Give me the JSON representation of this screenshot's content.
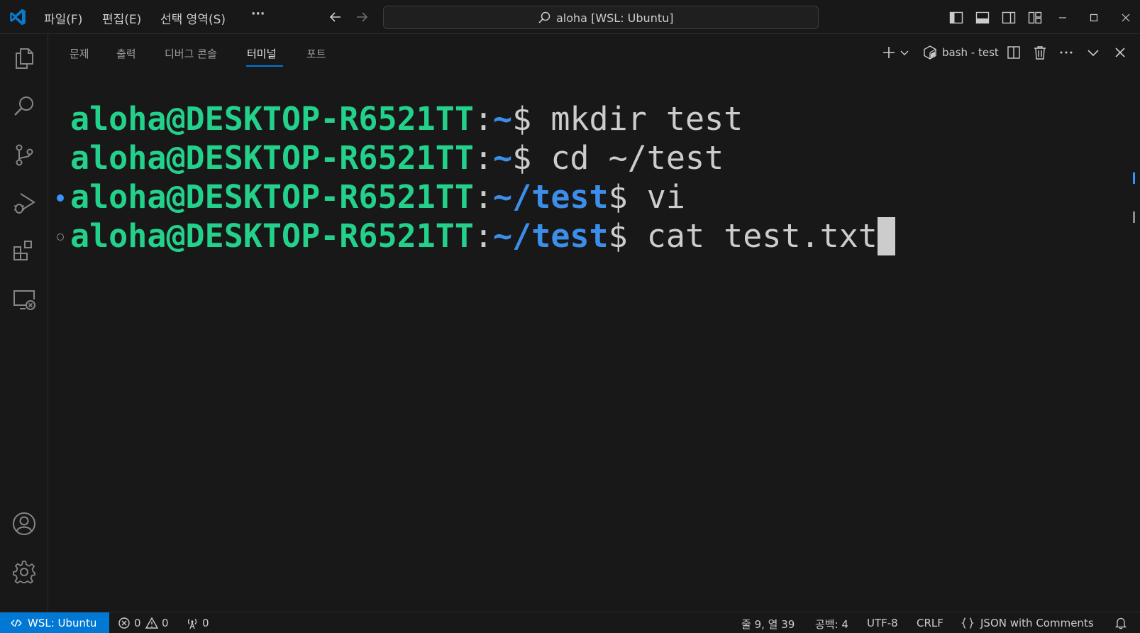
{
  "menu": {
    "file": "파일(F)",
    "edit": "편집(E)",
    "selection": "선택 영역(S)",
    "more": "···"
  },
  "search": {
    "text": "aloha [WSL: Ubuntu]"
  },
  "panel": {
    "tabs": [
      {
        "label": "문제"
      },
      {
        "label": "출력"
      },
      {
        "label": "디버그 콘솔"
      },
      {
        "label": "터미널",
        "active": true
      },
      {
        "label": "포트"
      }
    ],
    "terminal_name": "bash - test"
  },
  "terminal": {
    "lines": [
      {
        "user": "aloha@DESKTOP-R6521TT",
        "colon": ":",
        "path": "~",
        "dollar": "$",
        "command": " mkdir test"
      },
      {
        "user": "aloha@DESKTOP-R6521TT",
        "colon": ":",
        "path": "~",
        "dollar": "$",
        "command": " cd ~/test"
      },
      {
        "user": "aloha@DESKTOP-R6521TT",
        "colon": ":",
        "path": "~/test",
        "dollar": "$",
        "command": " vi"
      },
      {
        "user": "aloha@DESKTOP-R6521TT",
        "colon": ":",
        "path": "~/test",
        "dollar": "$",
        "command": " cat test.txt"
      }
    ]
  },
  "statusbar": {
    "remote": "WSL: Ubuntu",
    "errors": "0",
    "warnings": "0",
    "ports": "0",
    "position": "줄 9, 열 39",
    "spaces": "공백: 4",
    "encoding": "UTF-8",
    "eol": "CRLF",
    "language": "JSON with Comments"
  },
  "colors": {
    "accent": "#0078d4",
    "prompt_user": "#23d18b",
    "prompt_path": "#3b8eea",
    "background": "#181818"
  },
  "icons": {
    "title": [
      "vscode-logo",
      "arrow-left-icon",
      "arrow-right-icon",
      "search-icon",
      "toggle-primary-sidebar-icon",
      "toggle-panel-icon",
      "toggle-secondary-sidebar-icon",
      "customize-layout-icon",
      "minimize-icon",
      "maximize-icon",
      "close-icon"
    ],
    "activity": [
      "explorer-icon",
      "search-icon",
      "source-control-icon",
      "run-debug-icon",
      "extensions-icon",
      "remote-explorer-icon",
      "accounts-icon",
      "manage-gear-icon"
    ],
    "panel": [
      "new-terminal-icon",
      "terminal-dropdown-icon",
      "terminal-shell-icon",
      "split-terminal-icon",
      "kill-terminal-icon",
      "more-actions-icon",
      "maximize-panel-icon",
      "close-panel-icon"
    ],
    "status": [
      "remote-icon",
      "error-icon",
      "warning-icon",
      "ports-icon",
      "braces-icon",
      "bell-icon"
    ]
  }
}
